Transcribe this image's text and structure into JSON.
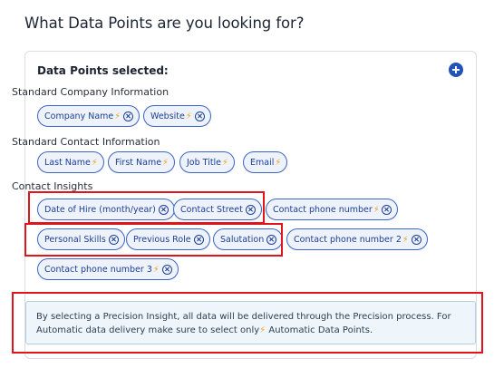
{
  "page_title": "What Data Points are you looking for?",
  "selected_title": "Data Points selected:",
  "groups": [
    {
      "label": "Standard Company Information",
      "chips": [
        {
          "label": "Company Name",
          "bolt": true,
          "removable": true
        },
        {
          "label": "Website",
          "bolt": true,
          "removable": true
        }
      ]
    },
    {
      "label": "Standard Contact Information",
      "chips": [
        {
          "label": "Last Name",
          "bolt": true,
          "removable": false
        },
        {
          "label": "First Name",
          "bolt": true,
          "removable": false
        },
        {
          "label": "Job Title",
          "bolt": true,
          "removable": false
        },
        {
          "label": "Email",
          "bolt": true,
          "removable": false
        }
      ]
    },
    {
      "label": "Contact Insights",
      "chips": [
        {
          "label": "Date of Hire (month/year)",
          "bolt": false,
          "removable": true
        },
        {
          "label": "Contact Street",
          "bolt": false,
          "removable": true
        },
        {
          "label": "Contact phone number",
          "bolt": true,
          "removable": true
        },
        {
          "label": "Personal Skills",
          "bolt": false,
          "removable": true
        },
        {
          "label": "Previous Role",
          "bolt": false,
          "removable": true
        },
        {
          "label": "Salutation",
          "bolt": false,
          "removable": true
        },
        {
          "label": "Contact phone number 2",
          "bolt": true,
          "removable": true
        },
        {
          "label": "Contact phone number 3",
          "bolt": true,
          "removable": true
        }
      ]
    }
  ],
  "info": {
    "text_before": "By selecting a Precision Insight, all data will be delivered through the Precision process. For Automatic data delivery make sure to select only",
    "bolt": "⚡",
    "text_after": " Automatic Data Points."
  },
  "bolt_symbol": "⚡",
  "colors": {
    "accent": "#2153b8",
    "chip_border": "#3d63c4",
    "chip_bg": "#edf2fb",
    "bolt": "#f0a323",
    "highlight": "#e0141b",
    "info_bg": "#eef5fb"
  }
}
